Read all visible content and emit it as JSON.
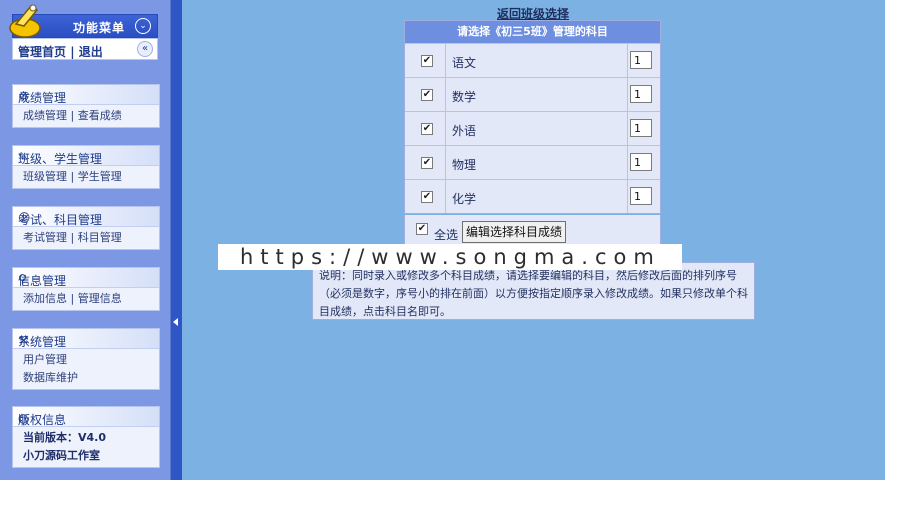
{
  "sidebar": {
    "menu_title": "功能菜单",
    "home_link": "管理首页",
    "separator": "|",
    "logout_link": "退出",
    "groups": [
      {
        "title": "成绩管理",
        "icon": "settings-icon",
        "links": [
          "成绩管理",
          "查看成绩"
        ]
      },
      {
        "title": "班级、学生管理",
        "icon": "edit-icon",
        "links": [
          "班级管理",
          "学生管理"
        ]
      },
      {
        "title": "考试、科目管理",
        "icon": "user-icon",
        "links": [
          "考试管理",
          "科目管理"
        ]
      },
      {
        "title": "信息管理",
        "icon": "search-icon",
        "links": [
          "添加信息",
          "管理信息"
        ]
      },
      {
        "title": "系统管理",
        "icon": "tools-icon",
        "links": [
          "用户管理",
          "数据库维护"
        ]
      },
      {
        "title": "版权信息",
        "icon": "globe-icon",
        "lines": [
          "当前版本：V4.0",
          "小刀源码工作室"
        ]
      }
    ]
  },
  "main": {
    "back_link": "返回班级选择",
    "table_header": "请选择《初三5班》管理的科目",
    "subjects": [
      {
        "name": "语文",
        "checked": true,
        "order": "1"
      },
      {
        "name": "数学",
        "checked": true,
        "order": "1"
      },
      {
        "name": "外语",
        "checked": true,
        "order": "1"
      },
      {
        "name": "物理",
        "checked": true,
        "order": "1"
      },
      {
        "name": "化学",
        "checked": true,
        "order": "1"
      }
    ],
    "select_all_label": "全选",
    "select_all_checked": true,
    "edit_button": "编辑选择科目成绩",
    "watermark": "https://www.songma.com",
    "note": "说明：同时录入或修改多个科目成绩，请选择要编辑的科目，然后修改后面的排列序号（必须是数字，序号小的排在前面）以方便按指定顺序录入修改成绩。如果只修改单个科目成绩，点击科目名即可。"
  },
  "colors": {
    "sidebar_bg": "#7c98e4",
    "splitter": "#2f56c6",
    "main_bg": "#7bb1e3",
    "table_header_bg": "#6e8edf"
  }
}
